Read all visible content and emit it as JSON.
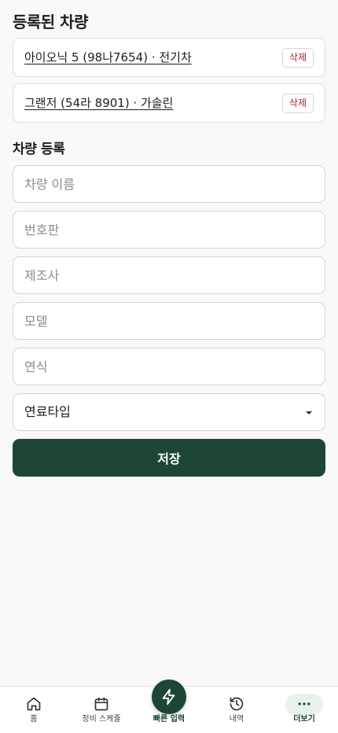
{
  "registered": {
    "title": "등록된 차량",
    "cars": [
      {
        "label": "아이오닉 5 (98나7654) · 전기차",
        "delete_label": "삭제"
      },
      {
        "label": "그랜저 (54라 8901) · 가솔린",
        "delete_label": "삭제"
      }
    ]
  },
  "register": {
    "title": "차량 등록",
    "fields": {
      "name_placeholder": "차량 이름",
      "plate_placeholder": "번호판",
      "maker_placeholder": "제조사",
      "model_placeholder": "모델",
      "year_placeholder": "연식"
    },
    "fuel_select": {
      "value": "연료타입"
    },
    "save_label": "저장"
  },
  "tabbar": {
    "items": [
      {
        "label": "홈",
        "icon": "home-icon"
      },
      {
        "label": "정비 스케줄",
        "icon": "calendar-icon"
      },
      {
        "label": "빠른 입력",
        "icon": "bolt-icon"
      },
      {
        "label": "내역",
        "icon": "history-icon"
      },
      {
        "label": "더보기",
        "icon": "more-icon"
      }
    ],
    "active": "더보기"
  },
  "colors": {
    "primary": "#1e4634",
    "danger": "#b3261e",
    "background": "#f9f9f9"
  }
}
